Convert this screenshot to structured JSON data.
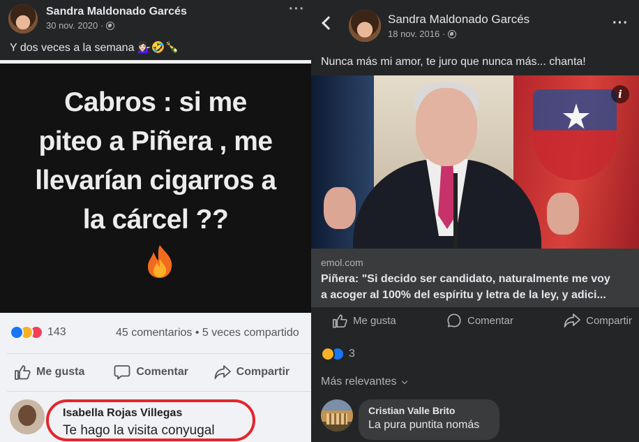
{
  "left_post": {
    "author": "Sandra Maldonado Garcés",
    "date": "30 nov. 2020 ·",
    "caption": "Y dos veces a la semana 💁🏻‍♀️🤣🍾",
    "meme_lines": [
      "Cabros : si me",
      "piteo a Piñera , me",
      "llevarían cigarros a",
      "la cárcel ??"
    ],
    "inner_post": {
      "reaction_count": "143",
      "comments_shares": "45 comentarios • 5 veces compartido",
      "actions": [
        "Me gusta",
        "Comentar",
        "Compartir"
      ],
      "comment": {
        "author": "Isabella Rojas Villegas",
        "text": "Te hago la visita conyugal"
      },
      "highlight_color": "#e2262d"
    }
  },
  "right_post": {
    "author": "Sandra Maldonado Garcés",
    "date": "18 nov. 2016 ·",
    "caption": "Nunca más mi amor, te juro que nunca más... chanta!",
    "link": {
      "domain": "emol.com",
      "title_line1": "Piñera: \"Si decido ser candidato, naturalmente me voy",
      "title_line2": "a acoger al 100% del espíritu y letra de la ley, y adici..."
    },
    "actions": [
      "Me gusta",
      "Comentar",
      "Compartir"
    ],
    "reaction_count": "3",
    "sort_label": "Más relevantes",
    "comment": {
      "author": "Cristian Valle Brito",
      "text": "La pura puntita nomás"
    }
  },
  "colors": {
    "background": "#242526",
    "primary_text": "#e4e6eb",
    "secondary_text": "#b0b3b8",
    "like_blue": "#1877f2",
    "love_red": "#f33e58",
    "haha_yellow": "#f7b125"
  },
  "icons": [
    "globe-icon",
    "more-options-icon",
    "back-chevron-icon",
    "like-icon",
    "comment-icon",
    "share-icon",
    "info-icon",
    "fire-emoji",
    "haha-reaction",
    "like-reaction",
    "love-reaction"
  ]
}
